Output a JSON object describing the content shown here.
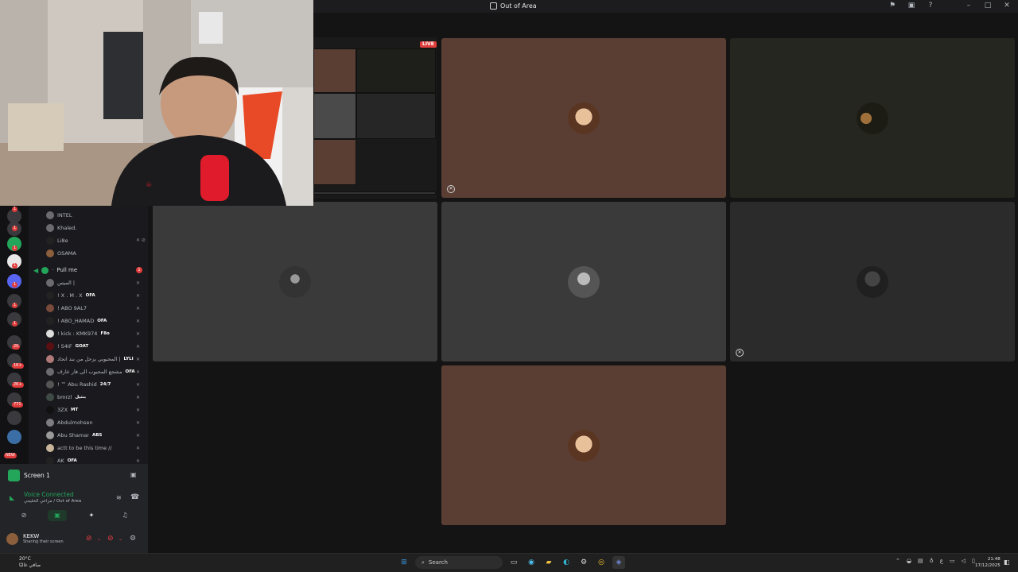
{
  "window": {
    "title": "Out of Area"
  },
  "share": {
    "live_label": "LIVE"
  },
  "sidebar": {
    "guild_badges": [
      "1",
      "1",
      "1",
      "1",
      "1",
      "1",
      "1",
      "20",
      "1K+",
      "2K+",
      "771",
      "NEW"
    ],
    "members_top": [
      {
        "name": "INTEL"
      },
      {
        "name": "Khaled."
      },
      {
        "name": "Li8e"
      },
      {
        "name": "OSAMA"
      }
    ],
    "active_channel": {
      "name": "Pull me",
      "badge": "1"
    },
    "members": [
      {
        "name": "الميس |",
        "tag": ""
      },
      {
        "name": "! X . M . X",
        "tag": "OFA"
      },
      {
        "name": "! ABO 9AL7",
        "tag": ""
      },
      {
        "name": "! ABO_HAMAD",
        "tag": "OFA"
      },
      {
        "name": "! kick : KMK974",
        "tag": "F8o"
      },
      {
        "name": "! S4IF",
        "tag": "GOAT"
      },
      {
        "name": "المحبوبي يزحل من بند انحاد |",
        "tag": "LYLI"
      },
      {
        "name": "مشجع المحبوب الى فار عارف",
        "tag": "OFA"
      },
      {
        "name": "! ™ Abu Rashid",
        "tag": "24/7"
      },
      {
        "name": "bmrzl",
        "tag": "بنتيل"
      },
      {
        "name": "3ZX",
        "tag": "MT"
      },
      {
        "name": "Abdulmohsen",
        "tag": ""
      },
      {
        "name": "Abu Shamar",
        "tag": "ABS"
      },
      {
        "name": "actt to be this time //",
        "tag": ""
      },
      {
        "name": "AK",
        "tag": "OFA"
      }
    ],
    "screen_label": "Screen 1",
    "voice_status": "Voice Connected",
    "voice_channel": "مزاعي الخليجي / Out of Area",
    "user": {
      "name": "KEKW",
      "status": "Sharing their screen"
    }
  },
  "taskbar": {
    "weather_temp": "20°C",
    "weather_text": "صافي غالبًا",
    "search_placeholder": "Search",
    "time": "21:48",
    "date": "17/12/2025",
    "lang": "ع"
  },
  "colors": {
    "tile_brown": "#5a3e34",
    "tile_gray": "#3a3a3a",
    "tile_dark": "#2b2b2b",
    "accent_green": "#23a55a",
    "accent_red": "#e03c3c"
  }
}
